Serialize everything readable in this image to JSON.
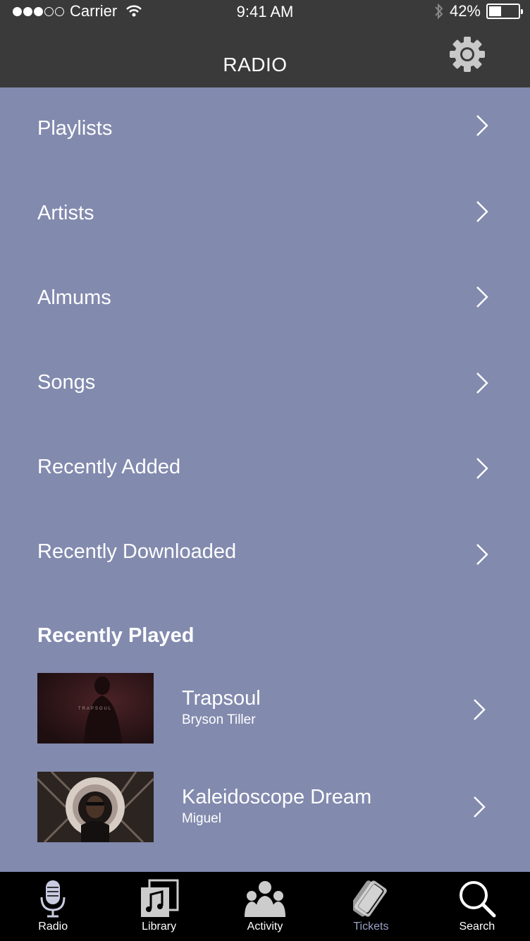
{
  "status_bar": {
    "carrier": "Carrier",
    "time": "9:41 AM",
    "battery": "42%",
    "battery_level": 0.42
  },
  "header": {
    "title": "RADIO",
    "settings_icon": "gear-icon"
  },
  "menu": {
    "items": [
      {
        "label": "Playlists"
      },
      {
        "label": "Artists"
      },
      {
        "label": "Almums"
      },
      {
        "label": "Songs"
      },
      {
        "label": "Recently Added"
      },
      {
        "label": "Recently Downloaded"
      }
    ]
  },
  "recently_played": {
    "title": "Recently Played",
    "items": [
      {
        "title": "Trapsoul",
        "artist": "Bryson Tiller",
        "cover_text": "TRAPSOUL"
      },
      {
        "title": "Kaleidoscope Dream",
        "artist": "Miguel"
      }
    ]
  },
  "tabbar": {
    "tabs": [
      {
        "label": "Radio",
        "icon": "microphone-icon"
      },
      {
        "label": "Library",
        "icon": "library-icon"
      },
      {
        "label": "Activity",
        "icon": "activity-icon"
      },
      {
        "label": "Tickets",
        "icon": "tickets-icon",
        "active": true
      },
      {
        "label": "Search",
        "icon": "search-icon"
      }
    ]
  },
  "colors": {
    "background": "#828aae",
    "header": "#3a3a3a",
    "tabbar": "#000000",
    "active_tab": "#9aa2c8"
  }
}
